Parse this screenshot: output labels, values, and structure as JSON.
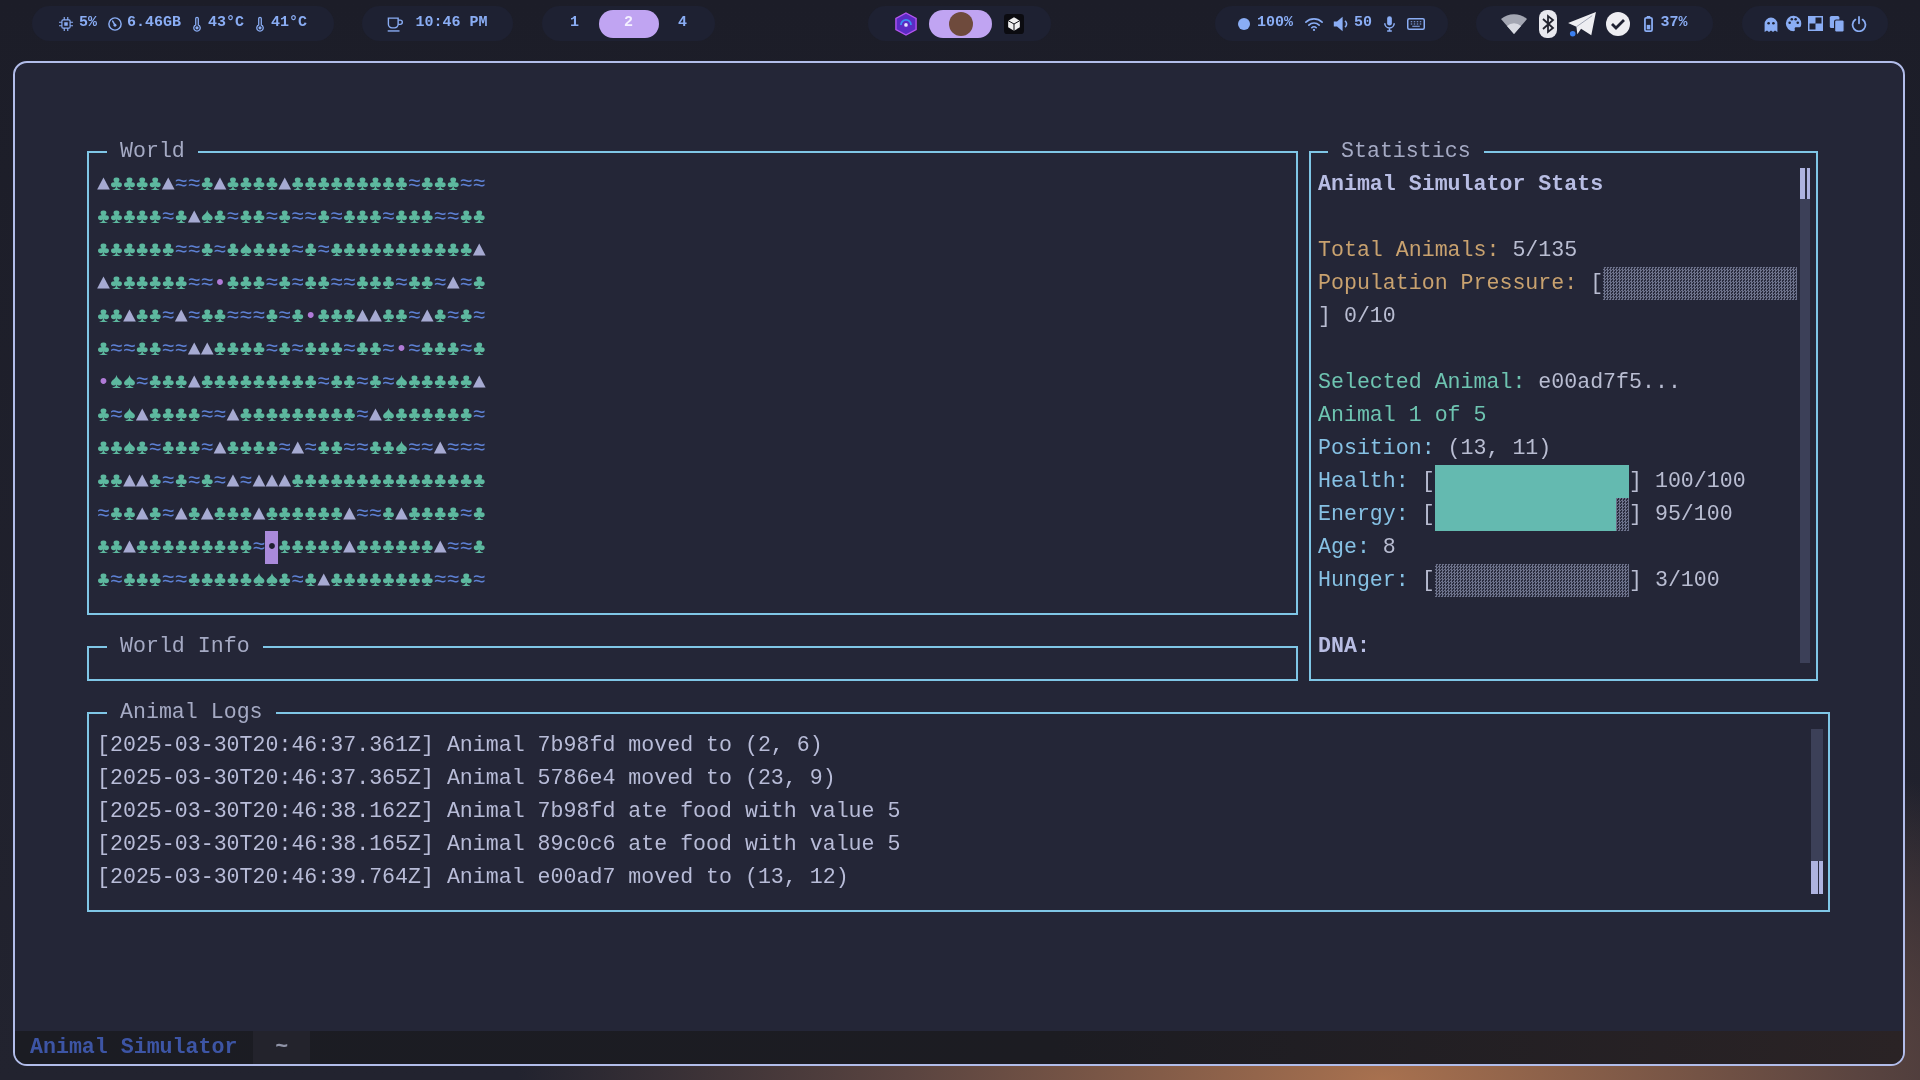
{
  "top_bar": {
    "cpu": "5%",
    "memory": "6.46GB",
    "temperatures": [
      "43°C",
      "41°C"
    ],
    "clock": "10:46 PM",
    "workspaces": [
      {
        "label": "1",
        "selected": false
      },
      {
        "label": "2",
        "selected": true
      },
      {
        "label": "4",
        "selected": false
      }
    ],
    "apps": [
      {
        "selected": false
      },
      {
        "selected": true
      },
      {
        "selected": false
      }
    ],
    "dot_reading": "100%",
    "volume": "50",
    "battery": "37%"
  },
  "world": {
    "title": "World",
    "rows": [
      [
        {
          "kind": "mountain",
          "text": "▲"
        },
        {
          "kind": "tree",
          "text": "♣"
        },
        {
          "kind": "tree",
          "text": "♣"
        },
        {
          "kind": "tree",
          "text": "♣"
        },
        {
          "kind": "tree",
          "text": "♣"
        },
        {
          "kind": "mountain",
          "text": "▲"
        },
        {
          "kind": "water",
          "text": "≈"
        },
        {
          "kind": "water",
          "text": "≈"
        },
        {
          "kind": "tree",
          "text": "♣"
        },
        {
          "kind": "mountain",
          "text": "▲"
        },
        {
          "kind": "tree",
          "text": "♣"
        },
        {
          "kind": "tree",
          "text": "♣"
        },
        {
          "kind": "tree",
          "text": "♣"
        },
        {
          "kind": "tree",
          "text": "♣"
        },
        {
          "kind": "mountain",
          "text": "▲"
        },
        {
          "kind": "tree",
          "text": "♣"
        },
        {
          "kind": "tree",
          "text": "♣"
        },
        {
          "kind": "tree",
          "text": "♣"
        },
        {
          "kind": "tree",
          "text": "♣"
        },
        {
          "kind": "tree",
          "text": "♣"
        },
        {
          "kind": "tree",
          "text": "♣"
        },
        {
          "kind": "tree",
          "text": "♣"
        },
        {
          "kind": "tree",
          "text": "♣"
        },
        {
          "kind": "tree",
          "text": "♣"
        },
        {
          "kind": "water",
          "text": "≈"
        },
        {
          "kind": "tree",
          "text": "♣"
        },
        {
          "kind": "tree",
          "text": "♣"
        },
        {
          "kind": "tree",
          "text": "♣"
        },
        {
          "kind": "water",
          "text": "≈"
        },
        {
          "kind": "water",
          "text": "≈"
        }
      ],
      [
        {
          "kind": "tree",
          "text": "♣"
        },
        {
          "kind": "tree",
          "text": "♣"
        },
        {
          "kind": "tree",
          "text": "♣"
        },
        {
          "kind": "tree",
          "text": "♣"
        },
        {
          "kind": "tree",
          "text": "♣"
        },
        {
          "kind": "water",
          "text": "≈"
        },
        {
          "kind": "tree",
          "text": "♣"
        },
        {
          "kind": "mountain",
          "text": "▲"
        },
        {
          "kind": "tree",
          "text": "♠"
        },
        {
          "kind": "tree",
          "text": "♣"
        },
        {
          "kind": "water",
          "text": "≈"
        },
        {
          "kind": "tree",
          "text": "♣"
        },
        {
          "kind": "tree",
          "text": "♣"
        },
        {
          "kind": "water",
          "text": "≈"
        },
        {
          "kind": "tree",
          "text": "♣"
        },
        {
          "kind": "water",
          "text": "≈"
        },
        {
          "kind": "water",
          "text": "≈"
        },
        {
          "kind": "tree",
          "text": "♣"
        },
        {
          "kind": "water",
          "text": "≈"
        },
        {
          "kind": "tree",
          "text": "♣"
        },
        {
          "kind": "tree",
          "text": "♣"
        },
        {
          "kind": "tree",
          "text": "♣"
        },
        {
          "kind": "water",
          "text": "≈"
        },
        {
          "kind": "tree",
          "text": "♣"
        },
        {
          "kind": "tree",
          "text": "♣"
        },
        {
          "kind": "tree",
          "text": "♣"
        },
        {
          "kind": "water",
          "text": "≈"
        },
        {
          "kind": "water",
          "text": "≈"
        },
        {
          "kind": "tree",
          "text": "♣"
        },
        {
          "kind": "tree",
          "text": "♣"
        }
      ],
      [
        {
          "kind": "tree",
          "text": "♣"
        },
        {
          "kind": "tree",
          "text": "♣"
        },
        {
          "kind": "tree",
          "text": "♣"
        },
        {
          "kind": "tree",
          "text": "♣"
        },
        {
          "kind": "tree",
          "text": "♣"
        },
        {
          "kind": "tree",
          "text": "♣"
        },
        {
          "kind": "water",
          "text": "≈"
        },
        {
          "kind": "water",
          "text": "≈"
        },
        {
          "kind": "tree",
          "text": "♣"
        },
        {
          "kind": "water",
          "text": "≈"
        },
        {
          "kind": "tree",
          "text": "♣"
        },
        {
          "kind": "tree",
          "text": "♠"
        },
        {
          "kind": "tree",
          "text": "♣"
        },
        {
          "kind": "tree",
          "text": "♣"
        },
        {
          "kind": "tree",
          "text": "♣"
        },
        {
          "kind": "water",
          "text": "≈"
        },
        {
          "kind": "tree",
          "text": "♣"
        },
        {
          "kind": "water",
          "text": "≈"
        },
        {
          "kind": "tree",
          "text": "♣"
        },
        {
          "kind": "tree",
          "text": "♣"
        },
        {
          "kind": "tree",
          "text": "♣"
        },
        {
          "kind": "tree",
          "text": "♣"
        },
        {
          "kind": "tree",
          "text": "♣"
        },
        {
          "kind": "tree",
          "text": "♣"
        },
        {
          "kind": "tree",
          "text": "♣"
        },
        {
          "kind": "tree",
          "text": "♣"
        },
        {
          "kind": "tree",
          "text": "♣"
        },
        {
          "kind": "tree",
          "text": "♣"
        },
        {
          "kind": "tree",
          "text": "♣"
        },
        {
          "kind": "mountain",
          "text": "▲"
        }
      ],
      [
        {
          "kind": "mountain",
          "text": "▲"
        },
        {
          "kind": "tree",
          "text": "♣"
        },
        {
          "kind": "tree",
          "text": "♣"
        },
        {
          "kind": "tree",
          "text": "♣"
        },
        {
          "kind": "tree",
          "text": "♣"
        },
        {
          "kind": "tree",
          "text": "♣"
        },
        {
          "kind": "tree",
          "text": "♣"
        },
        {
          "kind": "water",
          "text": "≈"
        },
        {
          "kind": "water",
          "text": "≈"
        },
        {
          "kind": "animal",
          "text": "•",
          "selected": false
        },
        {
          "kind": "tree",
          "text": "♣"
        },
        {
          "kind": "tree",
          "text": "♣"
        },
        {
          "kind": "tree",
          "text": "♣"
        },
        {
          "kind": "water",
          "text": "≈"
        },
        {
          "kind": "tree",
          "text": "♣"
        },
        {
          "kind": "water",
          "text": "≈"
        },
        {
          "kind": "tree",
          "text": "♣"
        },
        {
          "kind": "tree",
          "text": "♣"
        },
        {
          "kind": "water",
          "text": "≈"
        },
        {
          "kind": "water",
          "text": "≈"
        },
        {
          "kind": "tree",
          "text": "♣"
        },
        {
          "kind": "tree",
          "text": "♣"
        },
        {
          "kind": "tree",
          "text": "♣"
        },
        {
          "kind": "water",
          "text": "≈"
        },
        {
          "kind": "tree",
          "text": "♣"
        },
        {
          "kind": "tree",
          "text": "♣"
        },
        {
          "kind": "water",
          "text": "≈"
        },
        {
          "kind": "mountain",
          "text": "▲"
        },
        {
          "kind": "water",
          "text": "≈"
        },
        {
          "kind": "tree",
          "text": "♣"
        }
      ],
      [
        {
          "kind": "tree",
          "text": "♣"
        },
        {
          "kind": "tree",
          "text": "♣"
        },
        {
          "kind": "mountain",
          "text": "▲"
        },
        {
          "kind": "tree",
          "text": "♣"
        },
        {
          "kind": "tree",
          "text": "♣"
        },
        {
          "kind": "water",
          "text": "≈"
        },
        {
          "kind": "mountain",
          "text": "▲"
        },
        {
          "kind": "water",
          "text": "≈"
        },
        {
          "kind": "tree",
          "text": "♣"
        },
        {
          "kind": "tree",
          "text": "♣"
        },
        {
          "kind": "water",
          "text": "≈"
        },
        {
          "kind": "water",
          "text": "≈"
        },
        {
          "kind": "water",
          "text": "≈"
        },
        {
          "kind": "tree",
          "text": "♣"
        },
        {
          "kind": "water",
          "text": "≈"
        },
        {
          "kind": "tree",
          "text": "♣"
        },
        {
          "kind": "animal",
          "text": "•",
          "selected": false
        },
        {
          "kind": "tree",
          "text": "♣"
        },
        {
          "kind": "tree",
          "text": "♣"
        },
        {
          "kind": "tree",
          "text": "♣"
        },
        {
          "kind": "mountain",
          "text": "▲"
        },
        {
          "kind": "mountain",
          "text": "▲"
        },
        {
          "kind": "tree",
          "text": "♣"
        },
        {
          "kind": "tree",
          "text": "♣"
        },
        {
          "kind": "water",
          "text": "≈"
        },
        {
          "kind": "mountain",
          "text": "▲"
        },
        {
          "kind": "tree",
          "text": "♣"
        },
        {
          "kind": "water",
          "text": "≈"
        },
        {
          "kind": "tree",
          "text": "♣"
        },
        {
          "kind": "water",
          "text": "≈"
        }
      ],
      [
        {
          "kind": "tree",
          "text": "♣"
        },
        {
          "kind": "water",
          "text": "≈"
        },
        {
          "kind": "water",
          "text": "≈"
        },
        {
          "kind": "tree",
          "text": "♣"
        },
        {
          "kind": "tree",
          "text": "♣"
        },
        {
          "kind": "water",
          "text": "≈"
        },
        {
          "kind": "water",
          "text": "≈"
        },
        {
          "kind": "mountain",
          "text": "▲"
        },
        {
          "kind": "mountain",
          "text": "▲"
        },
        {
          "kind": "tree",
          "text": "♣"
        },
        {
          "kind": "tree",
          "text": "♣"
        },
        {
          "kind": "tree",
          "text": "♣"
        },
        {
          "kind": "tree",
          "text": "♣"
        },
        {
          "kind": "water",
          "text": "≈"
        },
        {
          "kind": "tree",
          "text": "♣"
        },
        {
          "kind": "water",
          "text": "≈"
        },
        {
          "kind": "tree",
          "text": "♣"
        },
        {
          "kind": "tree",
          "text": "♣"
        },
        {
          "kind": "tree",
          "text": "♣"
        },
        {
          "kind": "water",
          "text": "≈"
        },
        {
          "kind": "tree",
          "text": "♣"
        },
        {
          "kind": "tree",
          "text": "♣"
        },
        {
          "kind": "water",
          "text": "≈"
        },
        {
          "kind": "animal",
          "text": "•",
          "selected": false
        },
        {
          "kind": "water",
          "text": "≈"
        },
        {
          "kind": "tree",
          "text": "♣"
        },
        {
          "kind": "tree",
          "text": "♣"
        },
        {
          "kind": "tree",
          "text": "♣"
        },
        {
          "kind": "water",
          "text": "≈"
        },
        {
          "kind": "tree",
          "text": "♣"
        }
      ],
      [
        {
          "kind": "animal",
          "text": "•",
          "selected": false
        },
        {
          "kind": "tree",
          "text": "♠"
        },
        {
          "kind": "tree",
          "text": "♠"
        },
        {
          "kind": "water",
          "text": "≈"
        },
        {
          "kind": "tree",
          "text": "♣"
        },
        {
          "kind": "tree",
          "text": "♣"
        },
        {
          "kind": "tree",
          "text": "♣"
        },
        {
          "kind": "mountain",
          "text": "▲"
        },
        {
          "kind": "tree",
          "text": "♣"
        },
        {
          "kind": "tree",
          "text": "♣"
        },
        {
          "kind": "tree",
          "text": "♣"
        },
        {
          "kind": "tree",
          "text": "♣"
        },
        {
          "kind": "tree",
          "text": "♣"
        },
        {
          "kind": "tree",
          "text": "♣"
        },
        {
          "kind": "tree",
          "text": "♣"
        },
        {
          "kind": "tree",
          "text": "♣"
        },
        {
          "kind": "tree",
          "text": "♣"
        },
        {
          "kind": "water",
          "text": "≈"
        },
        {
          "kind": "tree",
          "text": "♣"
        },
        {
          "kind": "tree",
          "text": "♣"
        },
        {
          "kind": "water",
          "text": "≈"
        },
        {
          "kind": "tree",
          "text": "♣"
        },
        {
          "kind": "water",
          "text": "≈"
        },
        {
          "kind": "tree",
          "text": "♠"
        },
        {
          "kind": "tree",
          "text": "♣"
        },
        {
          "kind": "tree",
          "text": "♣"
        },
        {
          "kind": "tree",
          "text": "♣"
        },
        {
          "kind": "tree",
          "text": "♣"
        },
        {
          "kind": "tree",
          "text": "♣"
        },
        {
          "kind": "mountain",
          "text": "▲"
        }
      ],
      [
        {
          "kind": "tree",
          "text": "♣"
        },
        {
          "kind": "water",
          "text": "≈"
        },
        {
          "kind": "tree",
          "text": "♠"
        },
        {
          "kind": "mountain",
          "text": "▲"
        },
        {
          "kind": "tree",
          "text": "♣"
        },
        {
          "kind": "tree",
          "text": "♣"
        },
        {
          "kind": "tree",
          "text": "♣"
        },
        {
          "kind": "tree",
          "text": "♣"
        },
        {
          "kind": "water",
          "text": "≈"
        },
        {
          "kind": "water",
          "text": "≈"
        },
        {
          "kind": "mountain",
          "text": "▲"
        },
        {
          "kind": "tree",
          "text": "♣"
        },
        {
          "kind": "tree",
          "text": "♣"
        },
        {
          "kind": "tree",
          "text": "♣"
        },
        {
          "kind": "tree",
          "text": "♣"
        },
        {
          "kind": "tree",
          "text": "♣"
        },
        {
          "kind": "tree",
          "text": "♣"
        },
        {
          "kind": "tree",
          "text": "♣"
        },
        {
          "kind": "tree",
          "text": "♣"
        },
        {
          "kind": "tree",
          "text": "♣"
        },
        {
          "kind": "water",
          "text": "≈"
        },
        {
          "kind": "mountain",
          "text": "▲"
        },
        {
          "kind": "tree",
          "text": "♠"
        },
        {
          "kind": "tree",
          "text": "♣"
        },
        {
          "kind": "tree",
          "text": "♣"
        },
        {
          "kind": "tree",
          "text": "♣"
        },
        {
          "kind": "tree",
          "text": "♣"
        },
        {
          "kind": "tree",
          "text": "♣"
        },
        {
          "kind": "tree",
          "text": "♣"
        },
        {
          "kind": "water",
          "text": "≈"
        }
      ],
      [
        {
          "kind": "tree",
          "text": "♣"
        },
        {
          "kind": "tree",
          "text": "♣"
        },
        {
          "kind": "tree",
          "text": "♠"
        },
        {
          "kind": "tree",
          "text": "♣"
        },
        {
          "kind": "water",
          "text": "≈"
        },
        {
          "kind": "tree",
          "text": "♣"
        },
        {
          "kind": "tree",
          "text": "♣"
        },
        {
          "kind": "tree",
          "text": "♣"
        },
        {
          "kind": "water",
          "text": "≈"
        },
        {
          "kind": "mountain",
          "text": "▲"
        },
        {
          "kind": "tree",
          "text": "♣"
        },
        {
          "kind": "tree",
          "text": "♣"
        },
        {
          "kind": "tree",
          "text": "♣"
        },
        {
          "kind": "tree",
          "text": "♣"
        },
        {
          "kind": "water",
          "text": "≈"
        },
        {
          "kind": "mountain",
          "text": "▲"
        },
        {
          "kind": "water",
          "text": "≈"
        },
        {
          "kind": "tree",
          "text": "♣"
        },
        {
          "kind": "tree",
          "text": "♣"
        },
        {
          "kind": "water",
          "text": "≈"
        },
        {
          "kind": "water",
          "text": "≈"
        },
        {
          "kind": "tree",
          "text": "♣"
        },
        {
          "kind": "tree",
          "text": "♣"
        },
        {
          "kind": "tree",
          "text": "♠"
        },
        {
          "kind": "water",
          "text": "≈"
        },
        {
          "kind": "water",
          "text": "≈"
        },
        {
          "kind": "mountain",
          "text": "▲"
        },
        {
          "kind": "water",
          "text": "≈"
        },
        {
          "kind": "water",
          "text": "≈"
        },
        {
          "kind": "water",
          "text": "≈"
        }
      ],
      [
        {
          "kind": "tree",
          "text": "♣"
        },
        {
          "kind": "tree",
          "text": "♣"
        },
        {
          "kind": "mountain",
          "text": "▲"
        },
        {
          "kind": "mountain",
          "text": "▲"
        },
        {
          "kind": "tree",
          "text": "♣"
        },
        {
          "kind": "water",
          "text": "≈"
        },
        {
          "kind": "tree",
          "text": "♣"
        },
        {
          "kind": "water",
          "text": "≈"
        },
        {
          "kind": "tree",
          "text": "♣"
        },
        {
          "kind": "water",
          "text": "≈"
        },
        {
          "kind": "mountain",
          "text": "▲"
        },
        {
          "kind": "water",
          "text": "≈"
        },
        {
          "kind": "mountain",
          "text": "▲"
        },
        {
          "kind": "mountain",
          "text": "▲"
        },
        {
          "kind": "mountain",
          "text": "▲"
        },
        {
          "kind": "tree",
          "text": "♣"
        },
        {
          "kind": "tree",
          "text": "♣"
        },
        {
          "kind": "tree",
          "text": "♣"
        },
        {
          "kind": "tree",
          "text": "♣"
        },
        {
          "kind": "tree",
          "text": "♣"
        },
        {
          "kind": "tree",
          "text": "♣"
        },
        {
          "kind": "tree",
          "text": "♣"
        },
        {
          "kind": "tree",
          "text": "♣"
        },
        {
          "kind": "tree",
          "text": "♣"
        },
        {
          "kind": "tree",
          "text": "♣"
        },
        {
          "kind": "tree",
          "text": "♣"
        },
        {
          "kind": "tree",
          "text": "♣"
        },
        {
          "kind": "tree",
          "text": "♣"
        },
        {
          "kind": "tree",
          "text": "♣"
        },
        {
          "kind": "tree",
          "text": "♣"
        }
      ],
      [
        {
          "kind": "water",
          "text": "≈"
        },
        {
          "kind": "tree",
          "text": "♣"
        },
        {
          "kind": "tree",
          "text": "♣"
        },
        {
          "kind": "mountain",
          "text": "▲"
        },
        {
          "kind": "tree",
          "text": "♣"
        },
        {
          "kind": "water",
          "text": "≈"
        },
        {
          "kind": "mountain",
          "text": "▲"
        },
        {
          "kind": "tree",
          "text": "♣"
        },
        {
          "kind": "mountain",
          "text": "▲"
        },
        {
          "kind": "tree",
          "text": "♣"
        },
        {
          "kind": "tree",
          "text": "♣"
        },
        {
          "kind": "tree",
          "text": "♣"
        },
        {
          "kind": "mountain",
          "text": "▲"
        },
        {
          "kind": "tree",
          "text": "♣"
        },
        {
          "kind": "tree",
          "text": "♣"
        },
        {
          "kind": "tree",
          "text": "♣"
        },
        {
          "kind": "tree",
          "text": "♣"
        },
        {
          "kind": "tree",
          "text": "♣"
        },
        {
          "kind": "tree",
          "text": "♣"
        },
        {
          "kind": "mountain",
          "text": "▲"
        },
        {
          "kind": "water",
          "text": "≈"
        },
        {
          "kind": "water",
          "text": "≈"
        },
        {
          "kind": "tree",
          "text": "♣"
        },
        {
          "kind": "mountain",
          "text": "▲"
        },
        {
          "kind": "tree",
          "text": "♣"
        },
        {
          "kind": "tree",
          "text": "♣"
        },
        {
          "kind": "tree",
          "text": "♣"
        },
        {
          "kind": "tree",
          "text": "♣"
        },
        {
          "kind": "water",
          "text": "≈"
        },
        {
          "kind": "tree",
          "text": "♣"
        }
      ],
      [
        {
          "kind": "tree",
          "text": "♣"
        },
        {
          "kind": "tree",
          "text": "♣"
        },
        {
          "kind": "mountain",
          "text": "▲"
        },
        {
          "kind": "tree",
          "text": "♣"
        },
        {
          "kind": "tree",
          "text": "♣"
        },
        {
          "kind": "tree",
          "text": "♣"
        },
        {
          "kind": "tree",
          "text": "♣"
        },
        {
          "kind": "tree",
          "text": "♣"
        },
        {
          "kind": "tree",
          "text": "♣"
        },
        {
          "kind": "tree",
          "text": "♣"
        },
        {
          "kind": "tree",
          "text": "♣"
        },
        {
          "kind": "tree",
          "text": "♣"
        },
        {
          "kind": "water",
          "text": "≈"
        },
        {
          "kind": "animal",
          "text": "•",
          "selected": true
        },
        {
          "kind": "tree",
          "text": "♣"
        },
        {
          "kind": "tree",
          "text": "♣"
        },
        {
          "kind": "tree",
          "text": "♣"
        },
        {
          "kind": "tree",
          "text": "♣"
        },
        {
          "kind": "tree",
          "text": "♣"
        },
        {
          "kind": "mountain",
          "text": "▲"
        },
        {
          "kind": "tree",
          "text": "♣"
        },
        {
          "kind": "tree",
          "text": "♣"
        },
        {
          "kind": "tree",
          "text": "♣"
        },
        {
          "kind": "tree",
          "text": "♣"
        },
        {
          "kind": "tree",
          "text": "♣"
        },
        {
          "kind": "tree",
          "text": "♣"
        },
        {
          "kind": "mountain",
          "text": "▲"
        },
        {
          "kind": "water",
          "text": "≈"
        },
        {
          "kind": "water",
          "text": "≈"
        },
        {
          "kind": "tree",
          "text": "♣"
        }
      ],
      [
        {
          "kind": "tree",
          "text": "♣"
        },
        {
          "kind": "water",
          "text": "≈"
        },
        {
          "kind": "tree",
          "text": "♣"
        },
        {
          "kind": "tree",
          "text": "♣"
        },
        {
          "kind": "tree",
          "text": "♣"
        },
        {
          "kind": "water",
          "text": "≈"
        },
        {
          "kind": "water",
          "text": "≈"
        },
        {
          "kind": "tree",
          "text": "♣"
        },
        {
          "kind": "tree",
          "text": "♣"
        },
        {
          "kind": "tree",
          "text": "♣"
        },
        {
          "kind": "tree",
          "text": "♣"
        },
        {
          "kind": "tree",
          "text": "♣"
        },
        {
          "kind": "tree",
          "text": "♠"
        },
        {
          "kind": "tree",
          "text": "♠"
        },
        {
          "kind": "tree",
          "text": "♣"
        },
        {
          "kind": "water",
          "text": "≈"
        },
        {
          "kind": "tree",
          "text": "♣"
        },
        {
          "kind": "mountain",
          "text": "▲"
        },
        {
          "kind": "tree",
          "text": "♣"
        },
        {
          "kind": "tree",
          "text": "♣"
        },
        {
          "kind": "tree",
          "text": "♣"
        },
        {
          "kind": "tree",
          "text": "♣"
        },
        {
          "kind": "tree",
          "text": "♣"
        },
        {
          "kind": "tree",
          "text": "♣"
        },
        {
          "kind": "tree",
          "text": "♣"
        },
        {
          "kind": "tree",
          "text": "♣"
        },
        {
          "kind": "water",
          "text": "≈"
        },
        {
          "kind": "water",
          "text": "≈"
        },
        {
          "kind": "tree",
          "text": "♣"
        },
        {
          "kind": "water",
          "text": "≈"
        }
      ]
    ]
  },
  "world_info": {
    "title": "World Info"
  },
  "statistics": {
    "title": "Statistics",
    "sections": [
      [
        {
          "kind": "heading",
          "text": "Animal Simulator Stats"
        }
      ],
      [
        {
          "kind": "pair",
          "label": "Total Animals:",
          "color": "#c9a26f",
          "value": "5/135"
        },
        {
          "kind": "meter",
          "label": "Population Pressure:",
          "color": "#c9a26f",
          "open": "[",
          "close": "]",
          "reading": "0/10"
        }
      ],
      [
        {
          "kind": "pair",
          "label": "Selected Animal:",
          "color": "#6ec4b1",
          "value": "e00ad7f5..."
        },
        {
          "kind": "text",
          "text": "Animal 1 of 5",
          "color": "#6ec4b1"
        },
        {
          "kind": "pair",
          "label": "Position:",
          "color": "#86c1e4",
          "value": "(13, 11)"
        },
        {
          "kind": "meter",
          "label": "Health:",
          "color": "#86c1e4",
          "open": "[",
          "level": 1,
          "close": "]",
          "reading": "100/100"
        },
        {
          "kind": "meter",
          "label": "Energy:",
          "color": "#86c1e4",
          "open": "[",
          "level": 0.95,
          "close": "]",
          "reading": "95/100"
        },
        {
          "kind": "pair",
          "label": "Age:",
          "color": "#86c1e4",
          "value": "8"
        },
        {
          "kind": "meter",
          "label": "Hunger:",
          "color": "#86c1e4",
          "open": "[",
          "close": "]",
          "reading": "3/100"
        }
      ],
      [
        {
          "kind": "heading",
          "text": "DNA:"
        }
      ]
    ]
  },
  "logs": {
    "title": "Animal Logs",
    "entries": [
      "[2025-03-30T20:46:37.361Z] Animal 7b98fd moved to (2, 6)",
      "[2025-03-30T20:46:37.365Z] Animal 5786e4 moved to (23, 9)",
      "[2025-03-30T20:46:38.162Z] Animal 7b98fd ate food with value 5",
      "[2025-03-30T20:46:38.165Z] Animal 89c0c6 ate food with value 5",
      "[2025-03-30T20:46:39.764Z] Animal e00ad7 moved to (13, 12)"
    ]
  },
  "status_bar": {
    "session": "Animal Simulator",
    "window": "~"
  }
}
